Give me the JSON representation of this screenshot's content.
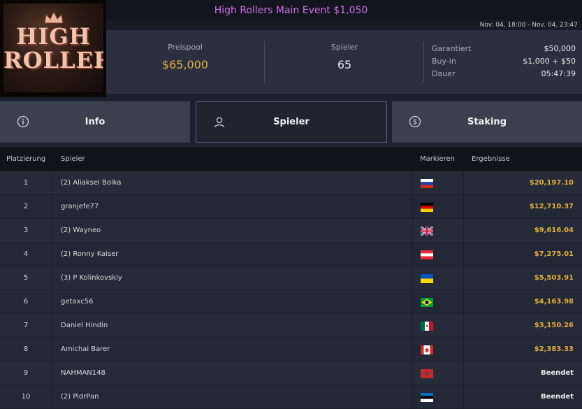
{
  "event": {
    "title": "High Rollers Main Event $1,050",
    "date_range": "Nov. 04, 18:00 - Nov. 04, 23:47"
  },
  "logo": {
    "line1": "HIGH",
    "line2": "ROLLERS"
  },
  "stats": {
    "prize_pool_label": "Preispool",
    "prize_pool_value": "$65,000",
    "players_label": "Spieler",
    "players_value": "65"
  },
  "details": [
    {
      "key": "Garantiert",
      "value": "$50,000"
    },
    {
      "key": "Buy-in",
      "value": "$1,000 + $50"
    },
    {
      "key": "Dauer",
      "value": "05:47:39"
    }
  ],
  "tabs": {
    "info": {
      "label": "Info",
      "icon": "info-icon"
    },
    "spieler": {
      "label": "Spieler",
      "icon": "user-icon",
      "active": true
    },
    "staking": {
      "label": "Staking",
      "icon": "dollar-coin-icon"
    }
  },
  "table": {
    "headers": {
      "rank": "Platzierung",
      "player": "Spieler",
      "flag": "Markieren",
      "result": "Ergebnisse"
    },
    "rows": [
      {
        "rank": "1",
        "player": "(2) Aliaksei Boika",
        "flag": "russia-flag-icon",
        "result": "$20,197.10"
      },
      {
        "rank": "2",
        "player": "granjefe77",
        "flag": "germany-flag-icon",
        "result": "$12,710.37"
      },
      {
        "rank": "3",
        "player": "(2) Wayneo",
        "flag": "uk-flag-icon",
        "result": "$9,616.04"
      },
      {
        "rank": "4",
        "player": "(2) Ronny Kaiser",
        "flag": "austria-flag-icon",
        "result": "$7,275.01"
      },
      {
        "rank": "5",
        "player": "(3) P Kolinkovskiy",
        "flag": "ukraine-flag-icon",
        "result": "$5,503.91"
      },
      {
        "rank": "6",
        "player": "getaxc56",
        "flag": "brazil-flag-icon",
        "result": "$4,163.98"
      },
      {
        "rank": "7",
        "player": "Daniel Hindin",
        "flag": "mexico-flag-icon",
        "result": "$3,150.26"
      },
      {
        "rank": "8",
        "player": "Amichai Barer",
        "flag": "canada-flag-icon",
        "result": "$2,383.33"
      },
      {
        "rank": "9",
        "player": "NAHMAN148",
        "flag": "morocco-flag-icon",
        "result": "Beendet"
      },
      {
        "rank": "10",
        "player": "(2) PidrPan",
        "flag": "estonia-flag-icon",
        "result": "Beendet"
      }
    ]
  },
  "colors": {
    "title": "#d26ee6",
    "money": "#e3ad3c",
    "panel": "#2a3040",
    "tab": "#3a404e",
    "active_tab": "#1f2431"
  }
}
